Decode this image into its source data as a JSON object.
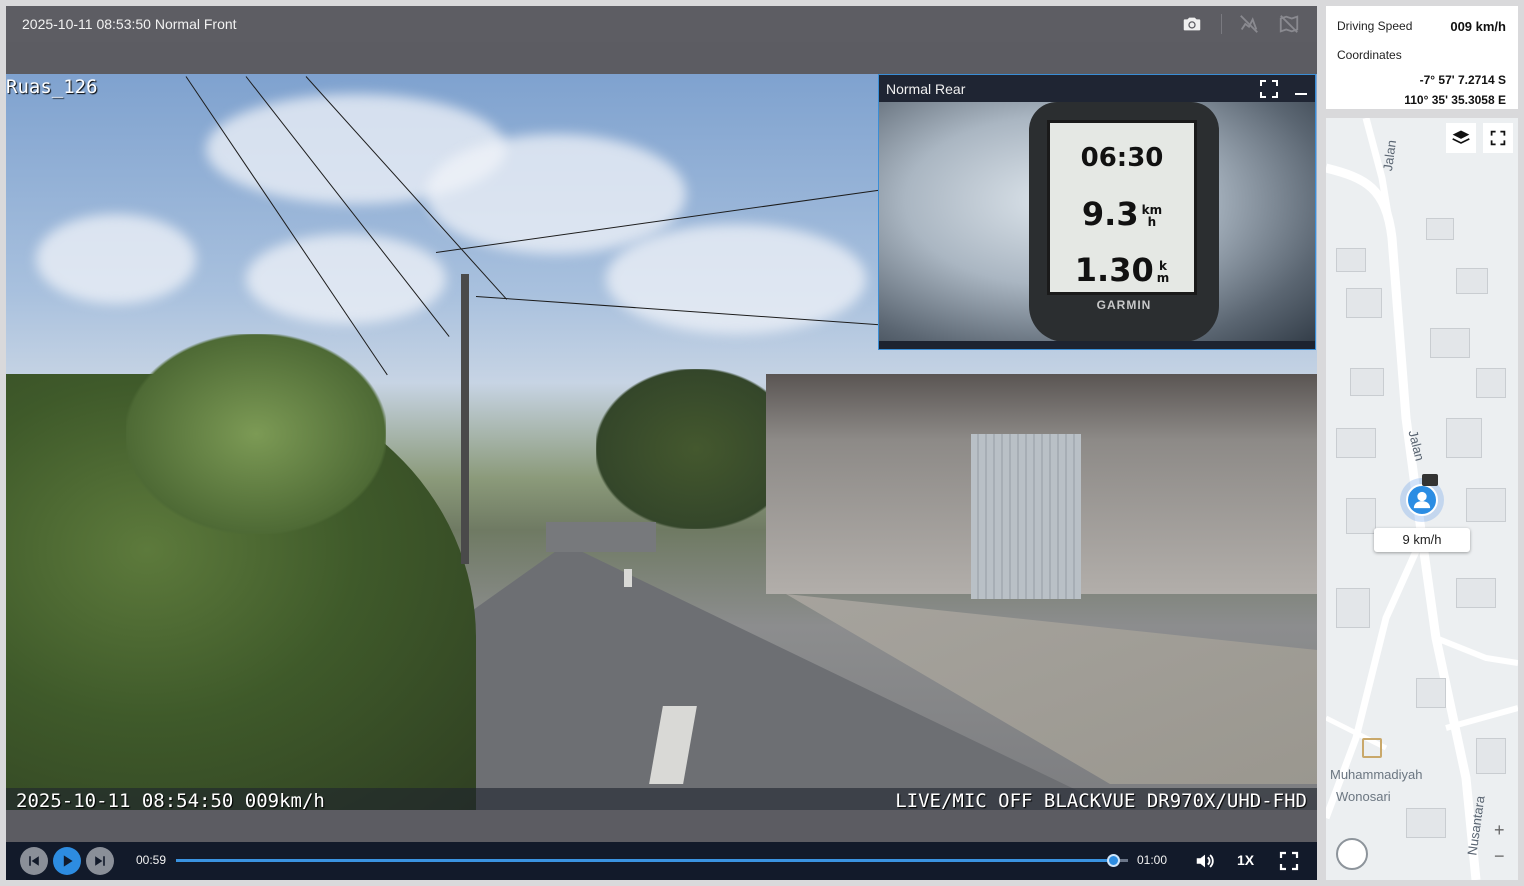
{
  "player": {
    "title": "2025-10-11 08:53:50 Normal Front",
    "overlay": {
      "camera_name": "Ruas_126",
      "bottom_left": "2025-10-11 08:54:50 009km/h",
      "bottom_right": "LIVE/MIC OFF BLACKVUE DR970X/UHD-FHD"
    },
    "header_icons": [
      "camera-icon",
      "hide-overlay-icon",
      "hide-map-icon"
    ]
  },
  "rear_view": {
    "title": "Normal Rear",
    "icons": [
      "expand-icon",
      "minimize-icon"
    ],
    "garmin": {
      "time": "06:30",
      "speed": "9.3",
      "speed_unit_top": "km",
      "speed_unit_bottom": "h",
      "distance": "1.30",
      "distance_unit_top": "k",
      "distance_unit_bottom": "m",
      "brand": "GARMIN"
    }
  },
  "controls": {
    "current_time": "00:59",
    "total_time": "01:00",
    "progress": 0.985,
    "playback_rate": "1X",
    "icons": [
      "prev-icon",
      "play-icon",
      "next-icon",
      "volume-icon",
      "fullscreen-icon"
    ]
  },
  "info": {
    "speed_label": "Driving Speed",
    "speed_value": "009 km/h",
    "coord_label": "Coordinates",
    "lat": "-7° 57' 7.2714 S",
    "lon": "110° 35' 35.3058 E"
  },
  "map": {
    "street_top": "Jalan",
    "street_mid": "Jalan",
    "street_bottom": "Nusantara",
    "poi_line1": "Muhammadiyah",
    "poi_line2": "Wonosari",
    "speed_pill": "9 km/h",
    "zoom_in": "+",
    "zoom_out": "−",
    "icons": [
      "layers-icon",
      "map-fullscreen-icon",
      "compass-icon"
    ]
  },
  "colors": {
    "accent": "#2d8ce0",
    "control_bar": "#121a2a",
    "header": "#5d5d63"
  }
}
